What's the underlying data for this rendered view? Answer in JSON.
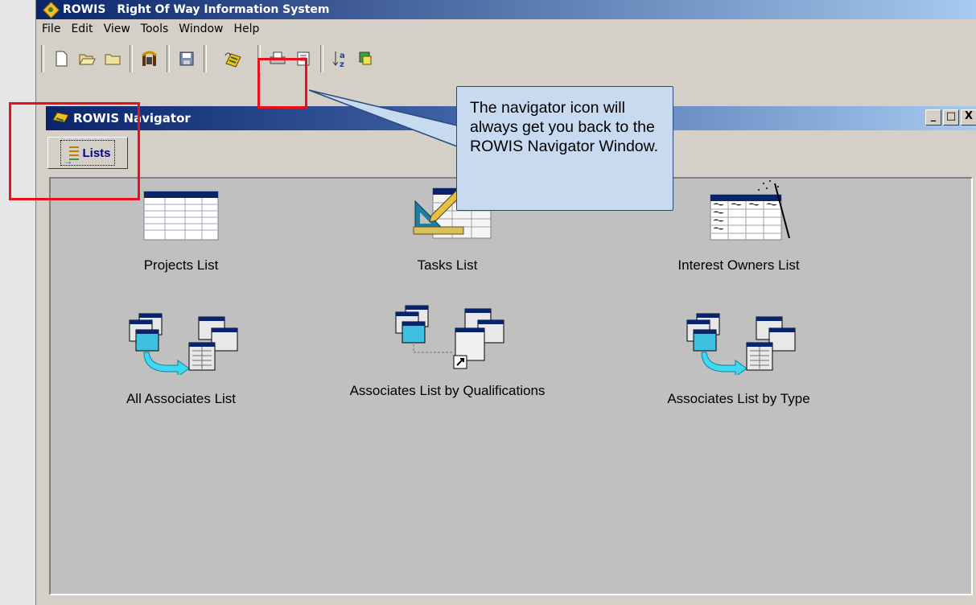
{
  "window": {
    "title_app": "ROWIS",
    "title_full": "Right Of Way Information System"
  },
  "menu": [
    "File",
    "Edit",
    "View",
    "Tools",
    "Window",
    "Help"
  ],
  "navigator": {
    "title": "ROWIS Navigator",
    "tab_label": "Lists"
  },
  "window_controls": {
    "minimize": "_",
    "maximize": "□",
    "close": "X"
  },
  "items": [
    {
      "label": "Projects List",
      "icon": "table-icon"
    },
    {
      "label": "Tasks List",
      "icon": "tasks-ruler-pencil-icon"
    },
    {
      "label": "Interest Owners List",
      "icon": "table-wand-icon"
    },
    {
      "label": "All Associates List",
      "icon": "associates-arrow-icon"
    },
    {
      "label": "Associates List by Qualifications",
      "icon": "associates-shortcut-icon"
    },
    {
      "label": "Associates List by Type",
      "icon": "associates-arrow-icon"
    }
  ],
  "callout": {
    "text": "The navigator icon will always get you back to the ROWIS Navigator Window."
  },
  "colors": {
    "titlebar_start": "#0a246a",
    "titlebar_end": "#a6caf0",
    "highlight": "#e8101c",
    "callout_bg": "#c8daf0"
  }
}
